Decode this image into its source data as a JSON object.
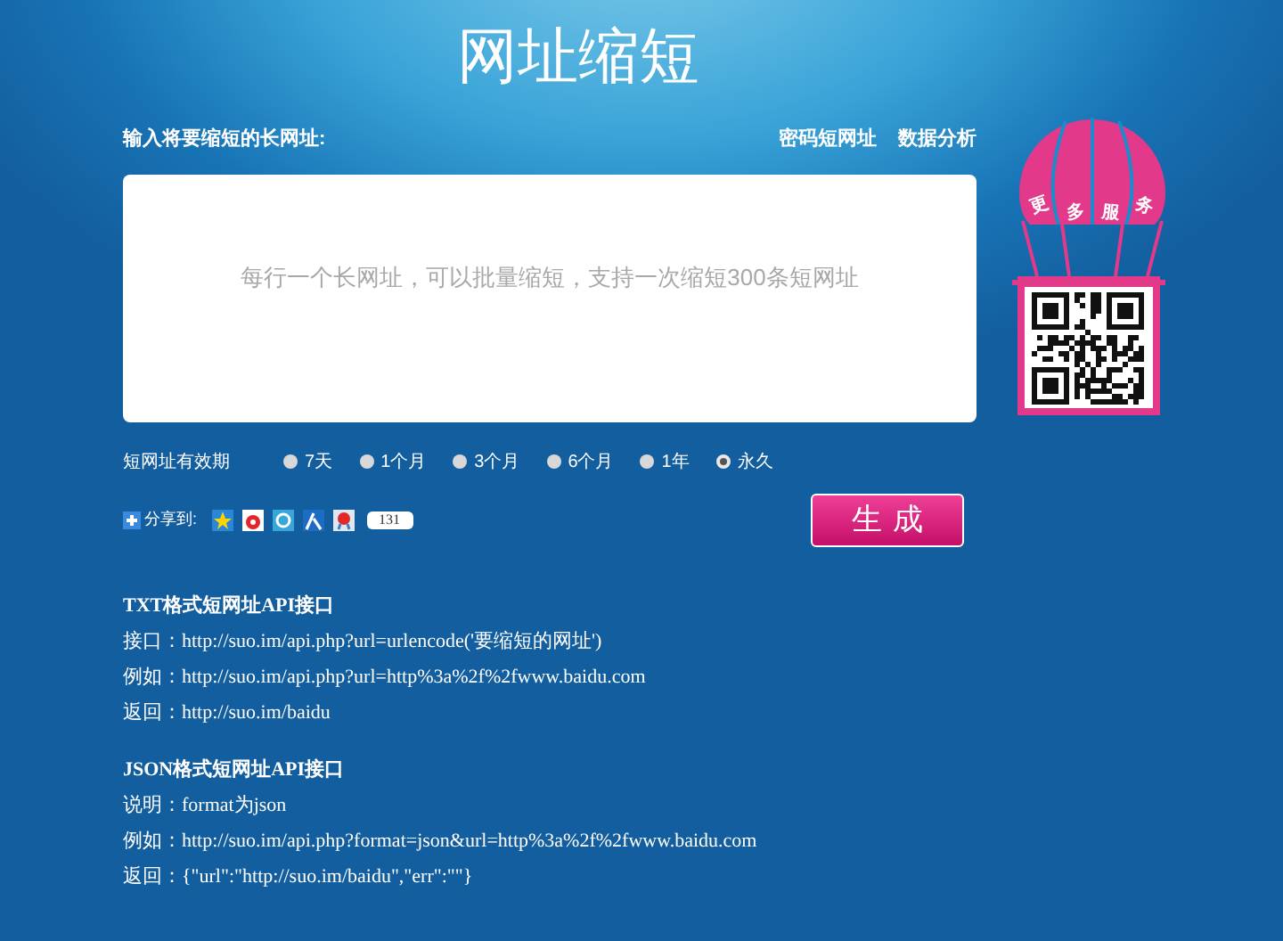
{
  "title": "网址缩短",
  "input_label": "输入将要缩短的长网址:",
  "links": [
    "密码短网址",
    "数据分析"
  ],
  "url_input": {
    "placeholder": "每行一个长网址，可以批量缩短，支持一次缩短300条短网址"
  },
  "balloon": {
    "label": [
      "更",
      "多",
      "服",
      "务"
    ]
  },
  "validity": {
    "label": "短网址有效期",
    "options": [
      {
        "label": "7天",
        "selected": false
      },
      {
        "label": "1个月",
        "selected": false
      },
      {
        "label": "3个月",
        "selected": false
      },
      {
        "label": "6个月",
        "selected": false
      },
      {
        "label": "1年",
        "selected": false
      },
      {
        "label": "永久",
        "selected": true
      }
    ]
  },
  "share": {
    "label": "分享到:",
    "count": "131"
  },
  "generate_button": "生成",
  "api_sections": [
    {
      "title": "TXT格式短网址API接口",
      "lines": [
        "接口：http://suo.im/api.php?url=urlencode('要缩短的网址')",
        "例如：http://suo.im/api.php?url=http%3a%2f%2fwww.baidu.com",
        "返回：http://suo.im/baidu"
      ]
    },
    {
      "title": "JSON格式短网址API接口",
      "lines": [
        "说明：format为json",
        "例如：http://suo.im/api.php?format=json&url=http%3a%2f%2fwww.baidu.com",
        "返回：{\"url\":\"http://suo.im/baidu\",\"err\":\"\"}"
      ]
    }
  ]
}
